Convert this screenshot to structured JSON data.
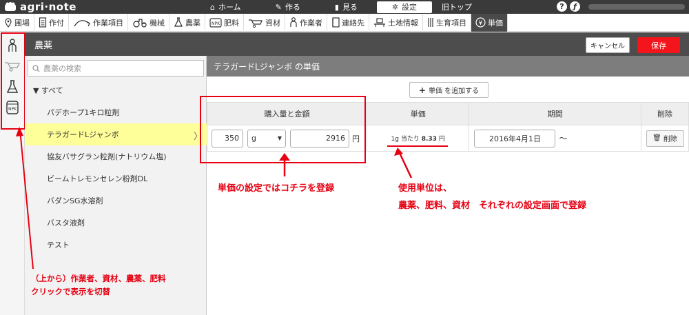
{
  "app": {
    "logo_text": "agri·note"
  },
  "topnav": [
    {
      "label": "ホーム",
      "icon": "home-icon"
    },
    {
      "label": "作る",
      "icon": "pencil-icon"
    },
    {
      "label": "見る",
      "icon": "book-icon"
    },
    {
      "label": "設定",
      "icon": "gear-icon",
      "active": true
    },
    {
      "label": "旧トップ",
      "icon": ""
    }
  ],
  "tabs": [
    {
      "label": "圃場",
      "icon": "pin-icon"
    },
    {
      "label": "作付",
      "icon": "document-icon"
    },
    {
      "label": "作業項目",
      "icon": "hoe-icon"
    },
    {
      "label": "機械",
      "icon": "tractor-icon"
    },
    {
      "label": "農薬",
      "icon": "flask-icon"
    },
    {
      "label": "肥料",
      "icon": "npk-icon"
    },
    {
      "label": "資材",
      "icon": "wheelbarrow-icon"
    },
    {
      "label": "作業者",
      "icon": "person-icon"
    },
    {
      "label": "連絡先",
      "icon": "address-book-icon"
    },
    {
      "label": "土地情報",
      "icon": "desk-icon"
    },
    {
      "label": "生育項目",
      "icon": "growth-icon"
    },
    {
      "label": "単価",
      "icon": "yen-icon",
      "active": true
    }
  ],
  "section": {
    "title": "農薬",
    "cancel_label": "キャンセル",
    "save_label": "保存"
  },
  "sidebar": {
    "search_placeholder": "農薬の検索",
    "root_label": "▼ すべて",
    "items": [
      "パデホープ1キロ粒剤",
      "テラガードLジャンボ",
      "協友バサグラン粒剤(ナトリウム塩)",
      "ビームトレモンセレン粉剤DL",
      "バダンSG水溶剤",
      "バスタ液剤",
      "テスト"
    ],
    "selected_index": 1
  },
  "main": {
    "title": "テラガードLジャンボ の単価",
    "add_button_label": "単価 を追加する",
    "columns": [
      "購入量と金額",
      "単価",
      "期間",
      "削除"
    ],
    "row": {
      "quantity": "350",
      "unit": "g",
      "amount": "2916",
      "currency": "円",
      "unit_price_prefix": "1g 当たり",
      "unit_price_value": "8.33",
      "unit_price_suffix": "円",
      "start_date": "2016年4月1日",
      "tilde": "〜",
      "delete_label": "削除"
    }
  },
  "annotations": {
    "price_setting": "単価の設定ではコチラを登録",
    "unit_line1": "使用単位は、",
    "unit_line2": "農薬、肥料、資材　それぞれの設定画面で登録",
    "sidebar_line1": "（上から）作業者、資材、農薬、肥料",
    "sidebar_line2": "クリックで表示を切替"
  },
  "colors": {
    "accent_red": "#e60012",
    "save_red": "#f3151b",
    "header_dark": "#3a3a3a",
    "selected_yellow": "#ffff99"
  }
}
